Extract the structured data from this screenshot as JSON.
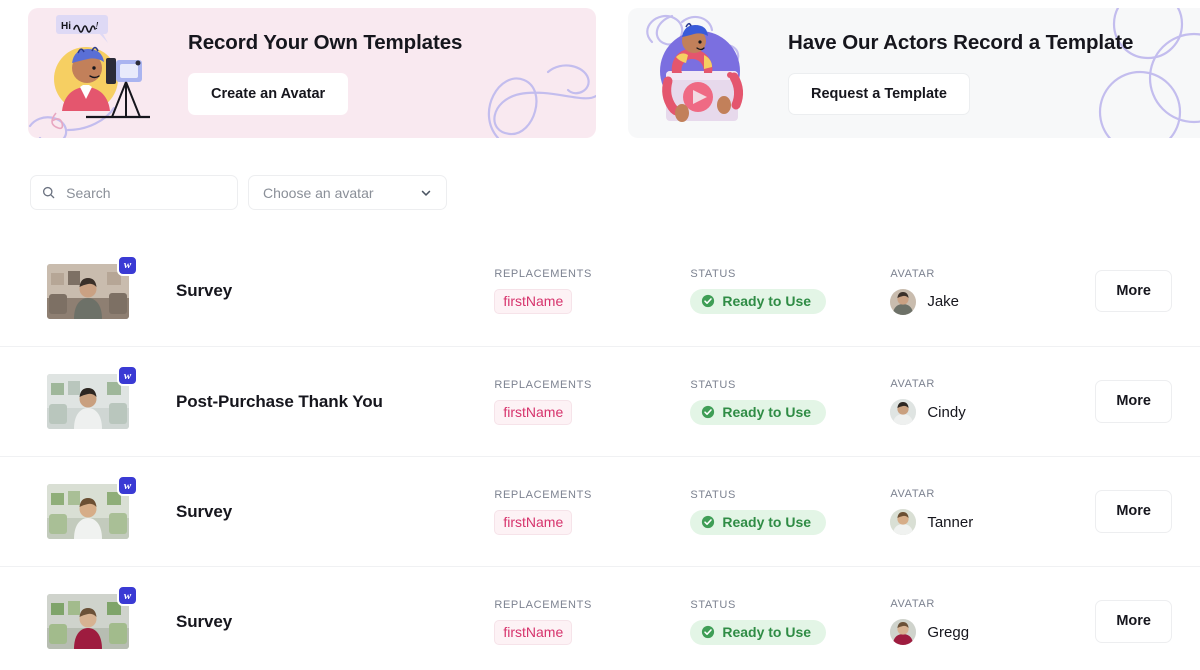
{
  "banners": [
    {
      "id": "record-own-templates",
      "title": "Record Your Own Templates",
      "button_label": "Create an Avatar",
      "bg_color": "#f9e9f0",
      "art": "person-with-camera-illustration"
    },
    {
      "id": "actors-record-template",
      "title": "Have Our Actors Record a Template",
      "button_label": "Request a Template",
      "bg_color": "#f7f8f9",
      "art": "person-with-video-player-illustration"
    }
  ],
  "filters": {
    "search": {
      "icon": "search-icon",
      "placeholder": "Search",
      "value": ""
    },
    "avatar_select": {
      "label": "Choose an avatar",
      "icon": "chevron-down-icon"
    }
  },
  "table": {
    "columns": {
      "replacements": "REPLACEMENTS",
      "status": "STATUS",
      "avatar": "AVATAR"
    },
    "action_label": "More",
    "rows": [
      {
        "title": "Survey",
        "badge": "w",
        "replacement": "firstName",
        "status": "Ready to Use",
        "status_icon": "check-circle-icon",
        "avatar_name": "Jake"
      },
      {
        "title": "Post-Purchase Thank You",
        "badge": "w",
        "replacement": "firstName",
        "status": "Ready to Use",
        "status_icon": "check-circle-icon",
        "avatar_name": "Cindy"
      },
      {
        "title": "Survey",
        "badge": "w",
        "replacement": "firstName",
        "status": "Ready to Use",
        "status_icon": "check-circle-icon",
        "avatar_name": "Tanner"
      },
      {
        "title": "Survey",
        "badge": "w",
        "replacement": "firstName",
        "status": "Ready to Use",
        "status_icon": "check-circle-icon",
        "avatar_name": "Gregg"
      }
    ]
  },
  "colors": {
    "accent_pink": "#f9e9f0",
    "accent_purple": "#b9b6e8",
    "status_green_bg": "#e3f5e6",
    "status_green_text": "#2f8c45",
    "chip_text": "#d6336c",
    "badge_blue": "#3a3ad4"
  }
}
